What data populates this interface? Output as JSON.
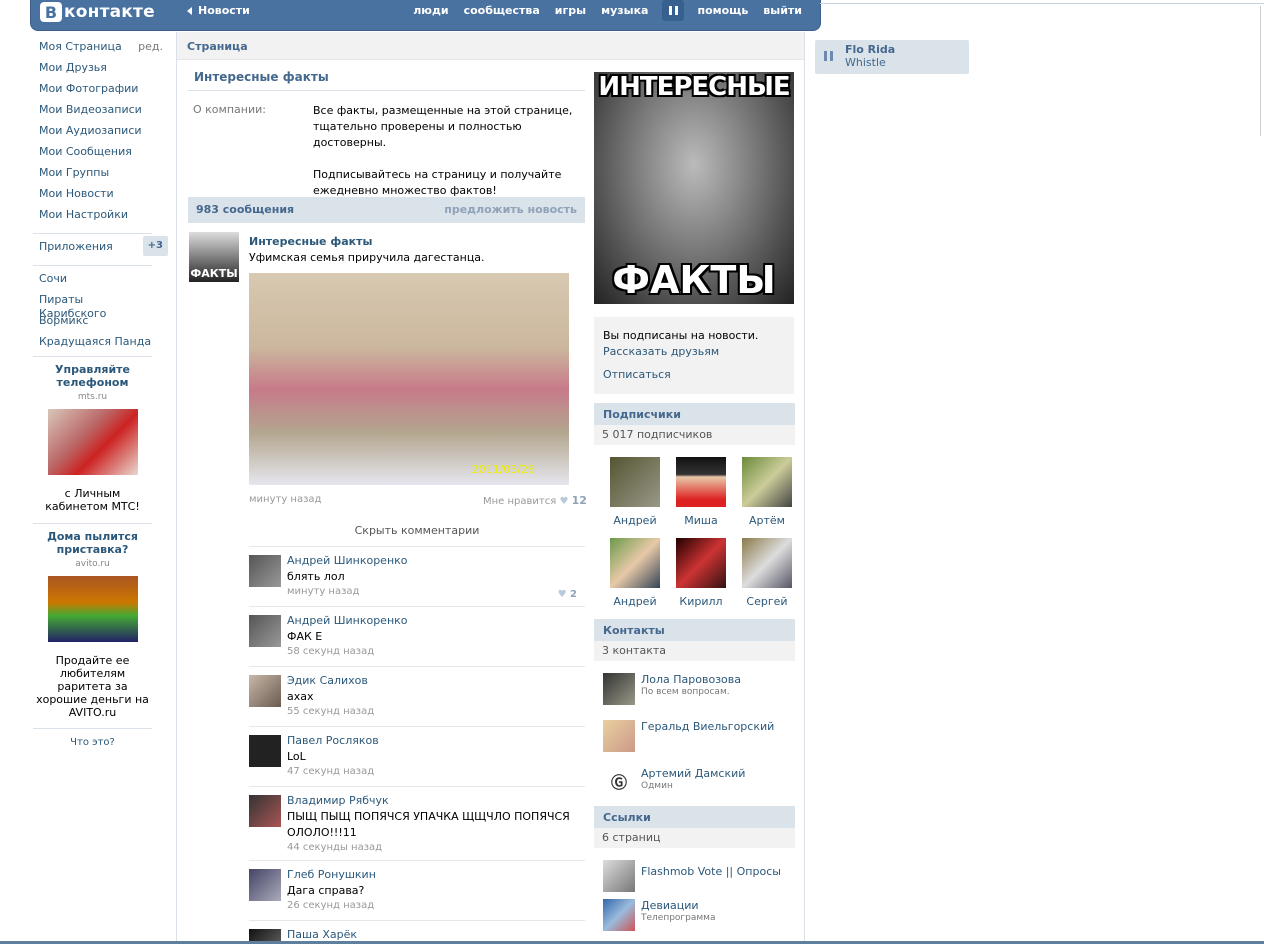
{
  "header": {
    "logo_letter": "В",
    "logo_text": "контакте",
    "back_label": "Новости",
    "nav": [
      "люди",
      "сообщества",
      "игры",
      "музыка",
      "помощь",
      "выйти"
    ]
  },
  "left_menu": {
    "items": [
      {
        "label": "Моя Страница",
        "extra": "ред."
      },
      {
        "label": "Мои Друзья"
      },
      {
        "label": "Мои Фотографии"
      },
      {
        "label": "Мои Видеозаписи"
      },
      {
        "label": "Мои Аудиозаписи"
      },
      {
        "label": "Мои Сообщения"
      },
      {
        "label": "Мои Группы"
      },
      {
        "label": "Мои Новости"
      },
      {
        "label": "Мои Настройки"
      }
    ],
    "apps_label": "Приложения",
    "apps_badge": "+3",
    "apps": [
      "Сочи",
      "Пираты Карибского",
      "Вормикс",
      "Крадущаяся Панда"
    ]
  },
  "ads": [
    {
      "title": "Управляйте телефоном",
      "domain": "mts.ru",
      "text": "с Личным кабинетом МТС!"
    },
    {
      "title": "Дома пылится приставка?",
      "domain": "avito.ru",
      "text": "Продайте ее любителям раритета за хорошие деньги на AVITO.ru"
    }
  ],
  "ads_help": "Что это?",
  "main": {
    "header": "Страница",
    "title": "Интересные факты",
    "info_label": "О компании:",
    "info_text_1": "Все факты, размещенные на этой странице, тщательно проверены и полностью достоверны.",
    "info_text_2": "Подписывайтесь на страницу и получайте ежедневно множество фактов!",
    "wall_count": "983 сообщения",
    "wall_suggest": "предложить новость"
  },
  "post": {
    "avatar_text": "ФАКТЫ",
    "author": "Интересные факты",
    "text": "Уфимская семья приручила дагестанца.",
    "photo_date": "2011/03/26",
    "time": "минуту назад",
    "like_label": "Мне нравится",
    "like_count": "12",
    "hide_comments": "Скрыть комментарии"
  },
  "comments": [
    {
      "name": "Андрей Шинкоренко",
      "text": "блять лол",
      "time": "минуту назад",
      "likes": "2"
    },
    {
      "name": "Андрей Шинкоренко",
      "text": "ФАК Е",
      "time": "58 секунд назад"
    },
    {
      "name": "Эдик Салихов",
      "text": "ахах",
      "time": "55 секунд назад"
    },
    {
      "name": "Павел Росляков",
      "text": "LoL",
      "time": "47 секунд назад"
    },
    {
      "name": "Владимир Рябчук",
      "text": "ПЫЩ ПЫЩ ПОПЯЧСЯ УПАЧКА ЩЩЧЛО ПОПЯЧСЯ ОЛОЛО!!!11",
      "time": "44 секунды назад"
    },
    {
      "name": "Глеб Ронушкин",
      "text": "Дага справа?",
      "time": "26 секунд назад"
    },
    {
      "name": "Паша Харёк",
      "text": "",
      "time": ""
    }
  ],
  "right": {
    "poster_top": "ИНТЕРЕСНЫЕ",
    "poster_bottom": "ФАКТЫ",
    "subscribed": "Вы подписаны на новости.",
    "tell_friends": "Рассказать друзьям",
    "unsubscribe": "Отписаться",
    "subscribers_title": "Подписчики",
    "subscribers_count": "5 017 подписчиков",
    "subscribers": [
      "Андрей",
      "Миша",
      "Артём",
      "Андрей",
      "Кирилл",
      "Сергей"
    ],
    "contacts_title": "Контакты",
    "contacts_count": "3 контакта",
    "contacts": [
      {
        "name": "Лола Паровозова",
        "desc": "По всем вопросам."
      },
      {
        "name": "Геральд Виельгорский",
        "desc": ""
      },
      {
        "name": "Артемий Дамский",
        "desc": "Одмин"
      }
    ],
    "links_title": "Ссылки",
    "links_count": "6 страниц",
    "links": [
      {
        "name": "Flashmob Vote || Опросы",
        "desc": ""
      },
      {
        "name": "Девиации",
        "desc": "Телепрограмма"
      }
    ]
  },
  "player": {
    "artist": "Flo Rida",
    "track": "Whistle"
  },
  "colors": {
    "header": "#4a72a0",
    "link": "#2b587a",
    "bar": "#dae2ea"
  }
}
